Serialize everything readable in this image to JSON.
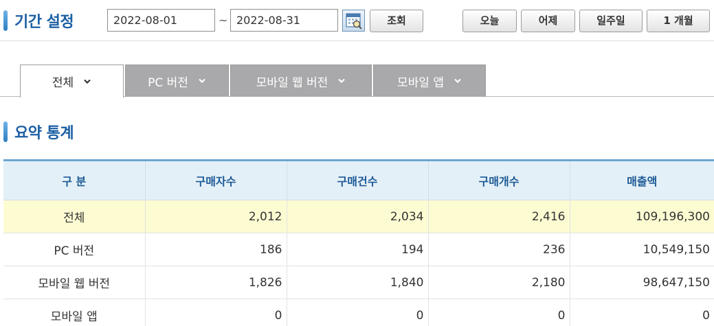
{
  "period": {
    "title": "기간 설정",
    "start_date": "2022-08-01",
    "end_date": "2022-08-31",
    "separator": "~",
    "search_label": "조회",
    "quick_buttons": [
      "오늘",
      "어제",
      "일주일",
      "1 개월"
    ]
  },
  "tabs": [
    {
      "label": "전체",
      "active": true
    },
    {
      "label": "PC 버전",
      "active": false
    },
    {
      "label": "모바일 웹 버전",
      "active": false
    },
    {
      "label": "모바일 앱",
      "active": false
    }
  ],
  "summary": {
    "title": "요약 통계",
    "columns": [
      "구 분",
      "구매자수",
      "구매건수",
      "구매개수",
      "매출액"
    ],
    "rows": [
      {
        "label": "전체",
        "buyers": "2,012",
        "orders": "2,034",
        "items": "2,416",
        "sales": "109,196,300"
      },
      {
        "label": "PC 버전",
        "buyers": "186",
        "orders": "194",
        "items": "236",
        "sales": "10,549,150"
      },
      {
        "label": "모바일 웹 버전",
        "buyers": "1,826",
        "orders": "1,840",
        "items": "2,180",
        "sales": "98,647,150"
      },
      {
        "label": "모바일 앱",
        "buyers": "0",
        "orders": "0",
        "items": "0",
        "sales": "0"
      }
    ]
  },
  "colors": {
    "accent": "#1b5fa3",
    "header_bg": "#e4f0f8",
    "total_row_bg": "#fdfbd2",
    "inactive_tab_bg": "#a9a9ab"
  }
}
